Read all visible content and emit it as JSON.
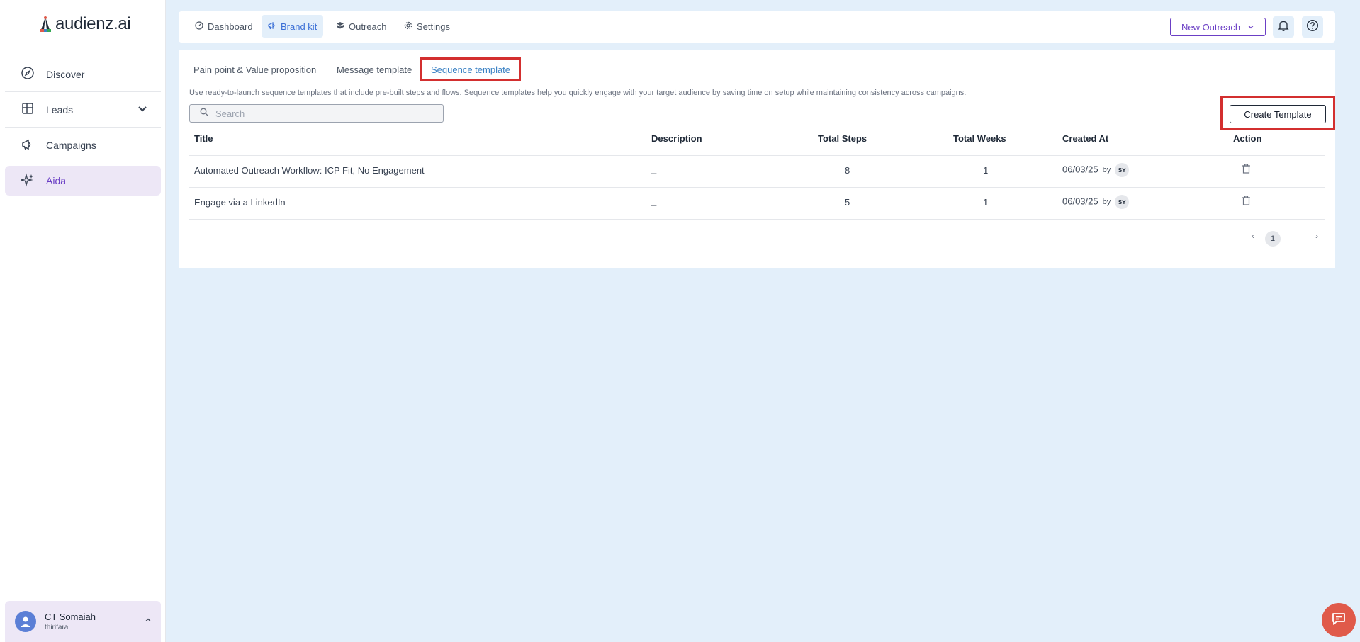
{
  "brand": {
    "name": "audienz.ai"
  },
  "sidebar": {
    "items": [
      {
        "label": "Discover",
        "icon": "compass-icon"
      },
      {
        "label": "Leads",
        "icon": "table-icon"
      },
      {
        "label": "Campaigns",
        "icon": "megaphone-icon"
      },
      {
        "label": "Aida",
        "icon": "sparkle-icon"
      }
    ],
    "user": {
      "name": "CT Somaiah",
      "org": "thirifara"
    }
  },
  "topbar": {
    "tabs": [
      {
        "label": "Dashboard",
        "icon": "gauge-icon"
      },
      {
        "label": "Brand kit",
        "icon": "megaphone-icon"
      },
      {
        "label": "Outreach",
        "icon": "box-icon"
      },
      {
        "label": "Settings",
        "icon": "gear-icon"
      }
    ],
    "new_outreach_label": "New Outreach"
  },
  "subtabs": [
    {
      "label": "Pain point & Value proposition"
    },
    {
      "label": "Message template"
    },
    {
      "label": "Sequence template"
    }
  ],
  "description": "Use ready-to-launch sequence templates that include pre-built steps and flows. Sequence templates help you quickly engage with your target audience by saving time on setup while maintaining consistency across campaigns.",
  "search": {
    "placeholder": "Search"
  },
  "create_label": "Create Template",
  "table": {
    "headers": {
      "title": "Title",
      "description": "Description",
      "steps": "Total Steps",
      "weeks": "Total Weeks",
      "created": "Created At",
      "action": "Action"
    },
    "rows": [
      {
        "title": "Automated Outreach Workflow: ICP Fit, No Engagement",
        "description": "_",
        "steps": "8",
        "weeks": "1",
        "date": "06/03/25",
        "by": "by",
        "initials": "SY"
      },
      {
        "title": "Engage via a LinkedIn",
        "description": "_",
        "steps": "5",
        "weeks": "1",
        "date": "06/03/25",
        "by": "by",
        "initials": "SY"
      }
    ]
  },
  "pagination": {
    "current": "1",
    "prev": "‹",
    "next": "›"
  },
  "colors": {
    "accent": "#6b3fc5",
    "highlight": "#d32f2f",
    "background": "#e3effa",
    "chat": "#e05a4a"
  }
}
